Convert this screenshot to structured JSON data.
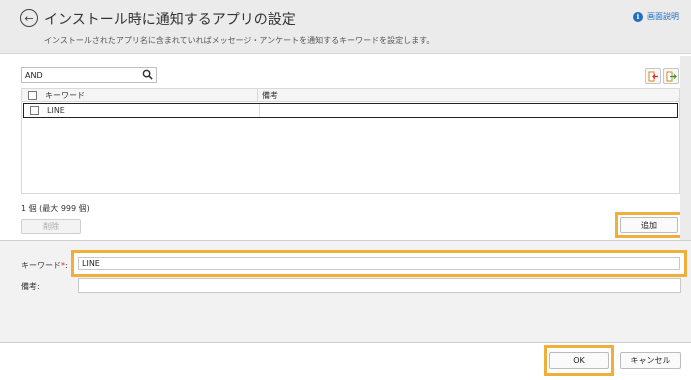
{
  "header": {
    "title": "インストール時に通知するアプリの設定",
    "description": "インストールされたアプリ名に含まれていればメッセージ・アンケートを通知するキーワードを設定します。",
    "help_label": "画面説明"
  },
  "search": {
    "value": "AND"
  },
  "table": {
    "columns": [
      "キーワード",
      "備考"
    ],
    "rows": [
      {
        "keyword": "LINE",
        "note": ""
      }
    ]
  },
  "list": {
    "count_text": "1 個 (最大 999 個)",
    "delete_label": "削除",
    "add_label": "追加"
  },
  "form": {
    "keyword_label": "キーワード",
    "required_mark": "*",
    "label_colon": ":",
    "keyword_value": "LINE",
    "note_label": "備考:",
    "note_value": ""
  },
  "footer": {
    "ok_label": "OK",
    "cancel_label": "キャンセル"
  },
  "colors": {
    "highlight": "#f0ae3a",
    "link": "#1d6fc1",
    "required": "#d02a2a"
  },
  "icons": [
    "back-arrow-icon",
    "info-icon",
    "search-icon",
    "import-icon",
    "export-icon",
    "chevron-down-icon"
  ]
}
